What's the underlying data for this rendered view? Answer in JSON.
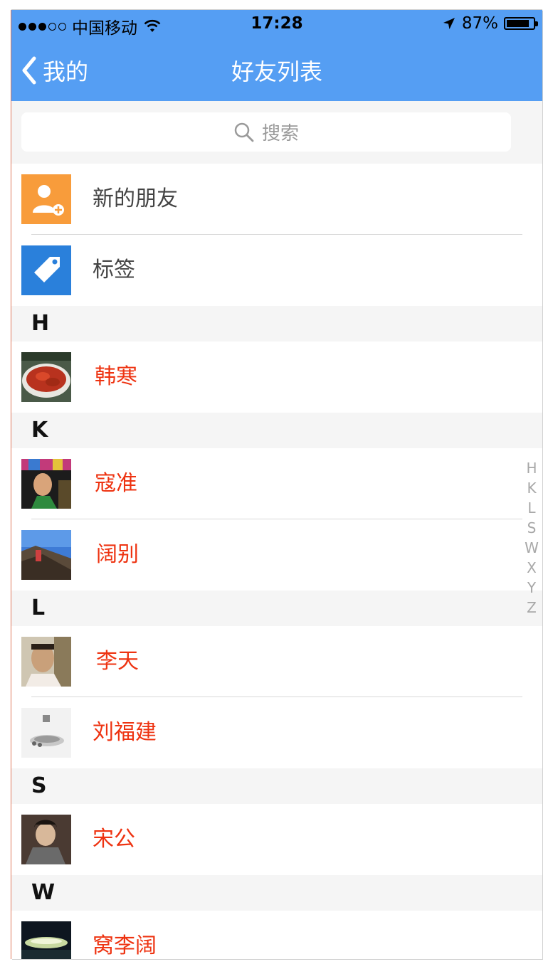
{
  "status_bar": {
    "carrier": "中国移动",
    "time": "17:28",
    "battery": "87%",
    "signal_bars": 3,
    "signal_total": 5,
    "battery_level": 0.87
  },
  "nav": {
    "back_label": "我的",
    "title": "好友列表"
  },
  "search": {
    "placeholder": "搜索"
  },
  "quick_items": [
    {
      "label": "新的朋友",
      "icon": "add-friend-icon",
      "color": "#f89c3b"
    },
    {
      "label": "标签",
      "icon": "tag-icon",
      "color": "#2a80db"
    }
  ],
  "sections": [
    {
      "letter": "H",
      "contacts": [
        "韩寒"
      ]
    },
    {
      "letter": "K",
      "contacts": [
        "寇准",
        "阔别"
      ]
    },
    {
      "letter": "L",
      "contacts": [
        "李天",
        "刘福建"
      ]
    },
    {
      "letter": "S",
      "contacts": [
        "宋公"
      ]
    },
    {
      "letter": "W",
      "contacts": [
        "窝李阔"
      ]
    }
  ],
  "index_letters": [
    "H",
    "K",
    "L",
    "S",
    "W",
    "X",
    "Y",
    "Z"
  ],
  "colors": {
    "nav_bg": "#559ef3",
    "contact_name": "#ee3311",
    "section_bg": "#f5f5f5"
  }
}
